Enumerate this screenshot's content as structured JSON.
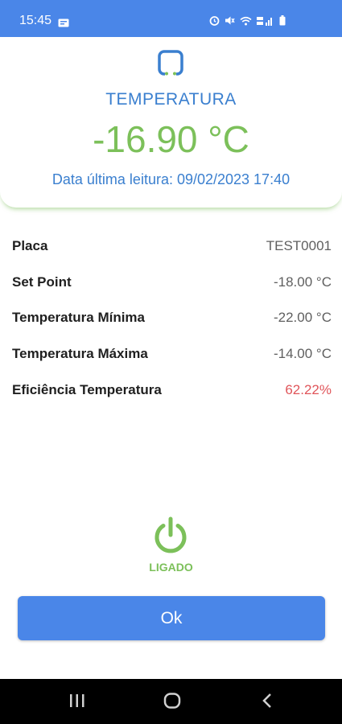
{
  "status_bar": {
    "time": "15:45"
  },
  "header": {
    "title": "TEMPERATURA",
    "temperature": "-16.90 °C",
    "last_reading": "Data última leitura: 09/02/2023 17:40"
  },
  "details": [
    {
      "label": "Placa",
      "value": "TEST0001"
    },
    {
      "label": "Set Point",
      "value": "-18.00 °C"
    },
    {
      "label": "Temperatura Mínima",
      "value": "-22.00 °C"
    },
    {
      "label": "Temperatura Máxima",
      "value": "-14.00 °C"
    },
    {
      "label": "Eficiência Temperatura",
      "value": "62.22%"
    }
  ],
  "power": {
    "status": "LIGADO",
    "icon": "power-icon"
  },
  "ok_button": {
    "label": "Ok"
  },
  "colors": {
    "primary_blue": "#4a86e8",
    "title_blue": "#3a7fcf",
    "green": "#7cc05a",
    "efficiency_red": "#e0555a"
  }
}
